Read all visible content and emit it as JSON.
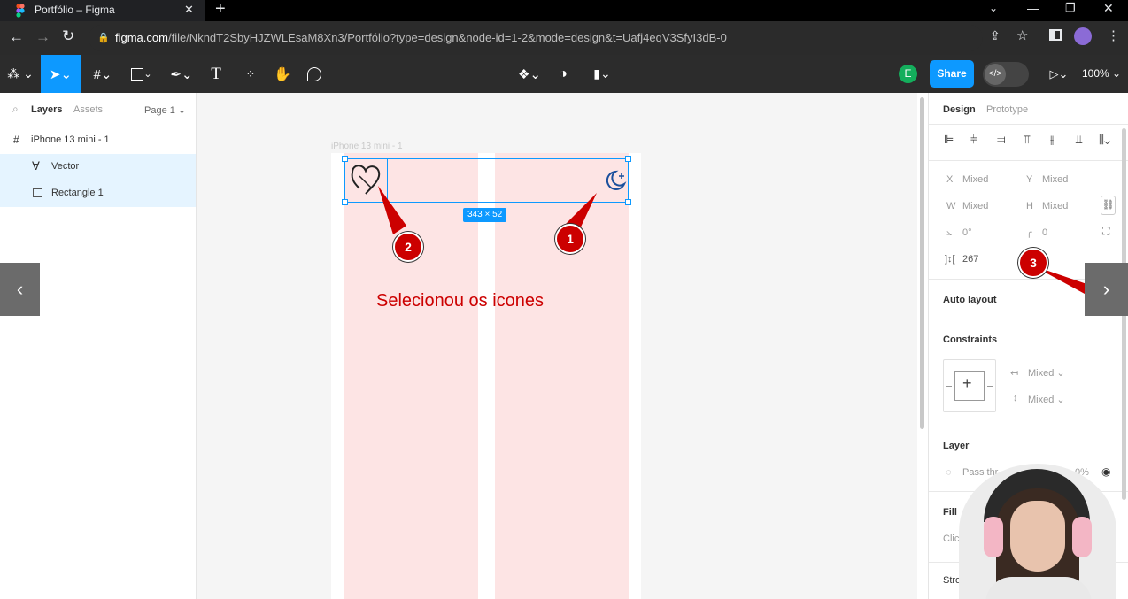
{
  "browser": {
    "tab_title": "Portfólio – Figma",
    "tab_close": "✕",
    "new_tab": "+",
    "url_domain": "figma.com",
    "url_path": "/file/NkndT2SbyHJZWLEsaM8Xn3/Portfólio?type=design&node-id=1-2&mode=design&t=Uafj4eqV3SfyI3dB-0"
  },
  "toolbar": {
    "avatar_initial": "E",
    "share_label": "Share",
    "zoom_label": "100%"
  },
  "left_panel": {
    "tabs": {
      "layers": "Layers",
      "assets": "Assets",
      "page": "Page 1"
    },
    "layers": [
      {
        "name": "iPhone 13 mini - 1",
        "icon": "frame-icon",
        "selected": false
      },
      {
        "name": "Vector",
        "icon": "vector-icon",
        "selected": true
      },
      {
        "name": "Rectangle 1",
        "icon": "image-icon",
        "selected": true
      }
    ]
  },
  "canvas": {
    "frame_label": "iPhone 13 mini - 1",
    "selection_size": "343 × 52",
    "annotation_text": "Selecionou os icones",
    "badges": [
      "1",
      "2",
      "3"
    ]
  },
  "right_panel": {
    "tabs": {
      "design": "Design",
      "prototype": "Prototype"
    },
    "x_label": "X",
    "x_value": "Mixed",
    "y_label": "Y",
    "y_value": "Mixed",
    "w_label": "W",
    "w_value": "Mixed",
    "h_label": "H",
    "h_value": "Mixed",
    "rotation_value": "0°",
    "radius_value": "0",
    "spacing_value": "267",
    "auto_layout_title": "Auto layout",
    "constraints_title": "Constraints",
    "constraint_h": "Mixed",
    "constraint_v": "Mixed",
    "layer_title": "Layer",
    "pass_through": "Pass thr",
    "opacity_partial": "0%",
    "fill_title": "Fill",
    "fill_hint": "Clic",
    "stroke_title": "Stroke"
  },
  "colors": {
    "accent": "#0d99ff",
    "annotation_red": "#cc0000",
    "column_pink": "#fde4e4"
  }
}
